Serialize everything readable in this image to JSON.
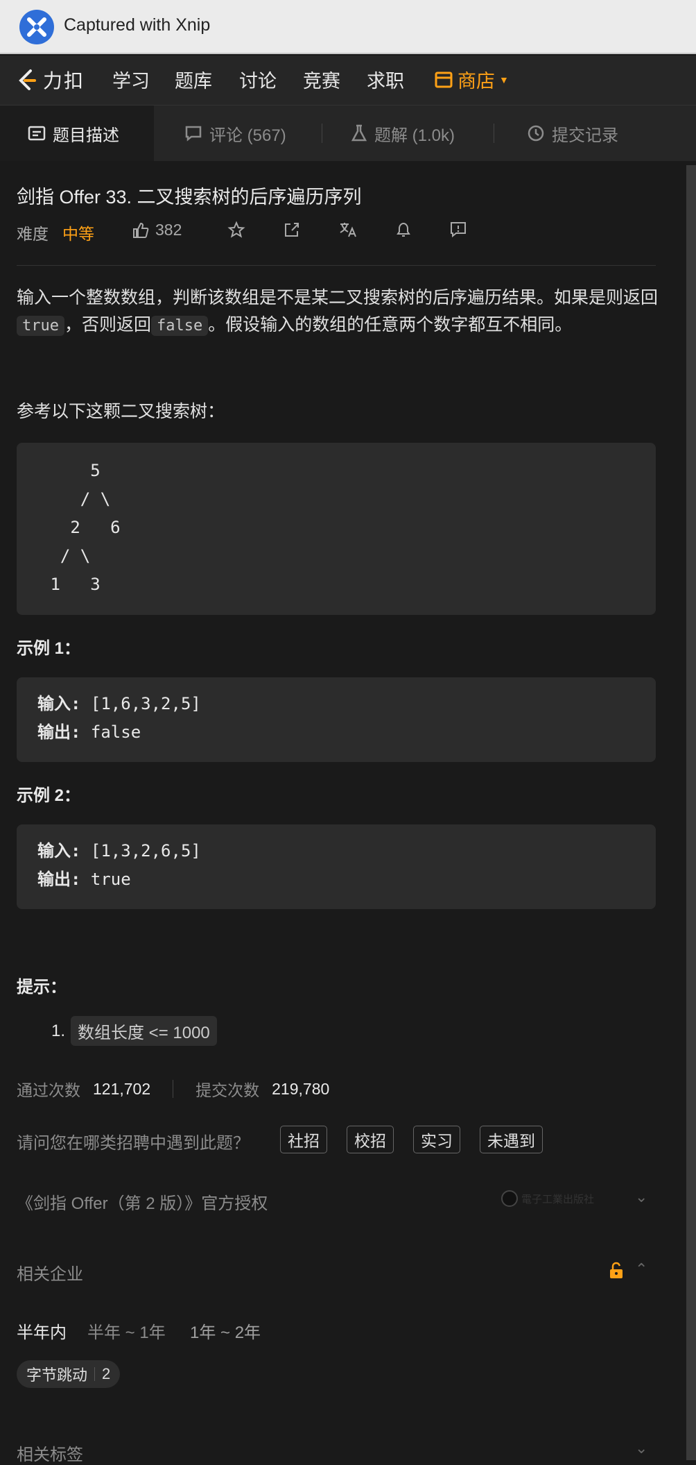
{
  "capture": {
    "title": "Captured with Xnip"
  },
  "nav": {
    "brand": "力扣",
    "items": [
      "学习",
      "题库",
      "讨论",
      "竞赛",
      "求职"
    ],
    "store": "商店"
  },
  "tabs": [
    {
      "label": "题目描述"
    },
    {
      "label": "评论 (567)"
    },
    {
      "label": "题解 (1.0k)"
    },
    {
      "label": "提交记录"
    }
  ],
  "problem": {
    "title": "剑指 Offer 33. 二叉搜索树的后序遍历序列",
    "difficulty_label": "难度",
    "difficulty": "中等",
    "likes": "382",
    "desc_1": "输入一个整数数组，判断该数组是不是某二叉搜索树的后序遍历结果。如果是则返回",
    "true_code": "true",
    "desc_2": "，否则返回",
    "false_code": "false",
    "desc_3": "。假设输入的数组的任意两个数字都互不相同。",
    "ref": "参考以下这颗二叉搜索树：",
    "tree": "     5\n    / \\\n   2   6\n  / \\\n 1   3",
    "example1_title": "示例 1：",
    "example1_in_label": "输入: ",
    "example1_in": "[1,6,3,2,5]",
    "example1_out_label": "输出: ",
    "example1_out": "false",
    "example2_title": "示例 2：",
    "example2_in_label": "输入: ",
    "example2_in": "[1,3,2,6,5]",
    "example2_out_label": "输出: ",
    "example2_out": "true",
    "hint_title": "提示：",
    "hint_num": "1.",
    "hint_text": "数组长度 <= 1000"
  },
  "stats": {
    "accepted_label": "通过次数",
    "accepted": "121,702",
    "submitted_label": "提交次数",
    "submitted": "219,780"
  },
  "survey": {
    "question": "请问您在哪类招聘中遇到此题？",
    "options": [
      "社招",
      "校招",
      "实习",
      "未遇到"
    ]
  },
  "license": {
    "text": "《剑指 Offer（第 2 版）》官方授权",
    "publisher": "電子工業出版社"
  },
  "companies": {
    "title": "相关企业",
    "periods": [
      "半年内",
      "半年 ~ 1年",
      "1年 ~ 2年"
    ],
    "entries": [
      {
        "name": "字节跳动",
        "count": "2"
      }
    ]
  },
  "tags": {
    "title": "相关标签"
  },
  "colors": {
    "accent": "#ffa116",
    "bg": "#1a1a1a",
    "panel": "#262626"
  }
}
